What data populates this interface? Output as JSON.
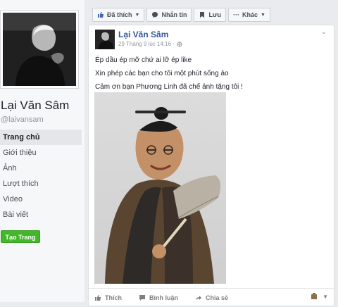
{
  "profile": {
    "name": "Lại Văn Sâm",
    "handle": "@laivansam"
  },
  "nav": [
    {
      "label": "Trang chủ"
    },
    {
      "label": "Giới thiệu"
    },
    {
      "label": "Ảnh"
    },
    {
      "label": "Lượt thích"
    },
    {
      "label": "Video"
    },
    {
      "label": "Bài viết"
    }
  ],
  "create_page_label": "Tạo Trang",
  "actions": {
    "liked": "Đã thích",
    "message": "Nhắn tin",
    "save": "Lưu",
    "more": "Khác"
  },
  "post": {
    "author": "Lại Văn Sâm",
    "time": "29 Tháng 9 lúc 14:16 · ",
    "lines": [
      "Ép dầu ép mỡ chứ ai lỡ ép like",
      "Xin phép các bạn cho tôi một phút sống ảo",
      "Cảm ơn bạn Phương Linh đã chế ảnh tặng tôi !"
    ],
    "footer": {
      "like": "Thích",
      "comment": "Bình luận",
      "share": "Chia sẻ"
    }
  },
  "colors": {
    "link": "#365899",
    "green": "#42b72a",
    "muted": "#90949c"
  }
}
